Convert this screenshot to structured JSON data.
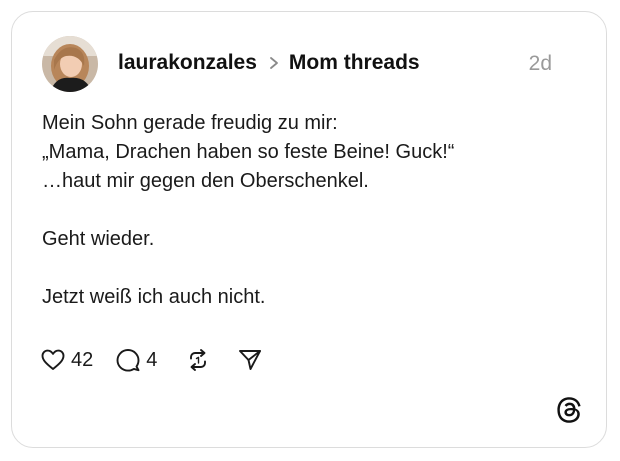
{
  "post": {
    "author": "laurakonzales",
    "community": "Mom threads",
    "timestamp": "2d",
    "body": "Mein Sohn gerade freudig zu mir:\n„Mama, Drachen haben so feste Beine! Guck!“\n…haut mir gegen den Oberschenkel.\n\nGeht wieder.\n\nJetzt weiß ich auch nicht.",
    "likes": "42",
    "replies": "4"
  },
  "icons": {
    "like": "heart-icon",
    "reply": "comment-icon",
    "repost": "repost-icon",
    "share": "send-icon",
    "breadcrumb": "chevron-right-icon",
    "brand": "threads-logo-icon"
  },
  "colors": {
    "text": "#1a1a1a",
    "muted": "#9a9a9a",
    "border": "#dcdcdc"
  }
}
